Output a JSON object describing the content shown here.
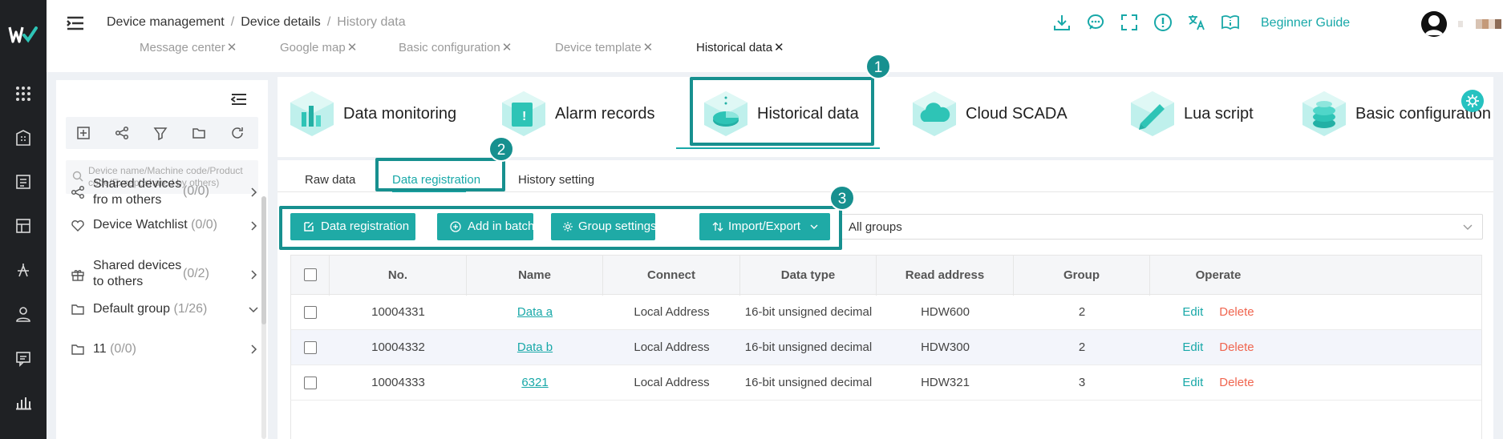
{
  "breadcrumb": {
    "items": [
      "Device management",
      "Device details"
    ],
    "current": "History data"
  },
  "tabs": [
    {
      "label": "Message center",
      "active": false
    },
    {
      "label": "Google map",
      "active": false
    },
    {
      "label": "Basic configuration",
      "active": false
    },
    {
      "label": "Device template",
      "active": false
    },
    {
      "label": "Historical data",
      "active": true
    }
  ],
  "header": {
    "icons": [
      "download-icon",
      "chat-icon",
      "fullscreen-icon",
      "alert-icon",
      "translate-icon",
      "guide-book-icon"
    ],
    "guide_label": "Beginner Guide"
  },
  "rail": {
    "icons": [
      "apps-grid-icon",
      "building-icon",
      "list-icon",
      "dashboard-icon",
      "bug-icon",
      "user-icon",
      "message-icon",
      "bar-chart-icon"
    ]
  },
  "sidebar": {
    "toolbar_icons": [
      "add-icon",
      "share-icon",
      "filter-icon",
      "folder-icon",
      "refresh-icon"
    ],
    "search_placeholder": "Device name/Machine code/Product code(Except shared by others)",
    "groups": [
      {
        "name": "Shared devices fro m others",
        "count": "(0/0)",
        "icon": "share-icon"
      },
      {
        "name": "Device Watchlist",
        "count": "(0/0)",
        "icon": "heart-icon"
      },
      {
        "name": "Shared devices to others",
        "count": "(0/2)",
        "icon": "gift-icon"
      },
      {
        "name": "Default group",
        "count": "(1/26)",
        "icon": "folder-icon",
        "expanded": true
      },
      {
        "name": "11",
        "count": "(0/0)",
        "icon": "folder-icon"
      }
    ]
  },
  "features": [
    {
      "label": "Data monitoring",
      "icon": "data-monitoring-icon"
    },
    {
      "label": "Alarm records",
      "icon": "alarm-records-icon"
    },
    {
      "label": "Historical data",
      "icon": "historical-data-icon",
      "active": true
    },
    {
      "label": "Cloud SCADA",
      "icon": "cloud-scada-icon"
    },
    {
      "label": "Lua script",
      "icon": "lua-script-icon"
    },
    {
      "label": "Basic configuration",
      "icon": "basic-config-icon"
    }
  ],
  "subtabs": [
    {
      "label": "Raw data",
      "active": false
    },
    {
      "label": "Data registration",
      "active": true
    },
    {
      "label": "History setting",
      "active": false
    }
  ],
  "actions": {
    "data_registration": "Data registration",
    "add_in_batch": "Add in batch",
    "group_settings": "Group settings",
    "import_export": "Import/Export"
  },
  "group_select": {
    "value": "All groups"
  },
  "table": {
    "columns": [
      "No.",
      "Name",
      "Connect",
      "Data type",
      "Read address",
      "Group",
      "Operate"
    ],
    "rows": [
      {
        "no": "10004331",
        "name": "Data a",
        "connect": "Local Address",
        "data_type": "16-bit unsigned decimal",
        "read_address": "HDW600",
        "group": "2"
      },
      {
        "no": "10004332",
        "name": "Data b",
        "connect": "Local Address",
        "data_type": "16-bit unsigned decimal",
        "read_address": "HDW300",
        "group": "2"
      },
      {
        "no": "10004333",
        "name": "6321",
        "connect": "Local Address",
        "data_type": "16-bit unsigned decimal",
        "read_address": "HDW321",
        "group": "3"
      }
    ],
    "edit_label": "Edit",
    "delete_label": "Delete"
  },
  "annotations": [
    "1",
    "2",
    "3"
  ],
  "colors": {
    "accent": "#18a8a8",
    "button": "#1faaa6",
    "highlight": "#17908f",
    "danger": "#f0654f",
    "rail": "#1f2124"
  }
}
